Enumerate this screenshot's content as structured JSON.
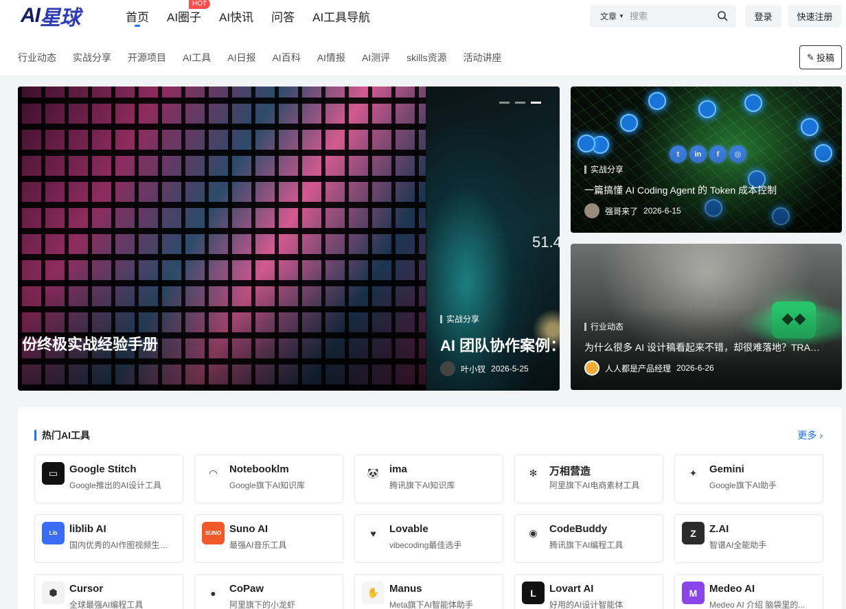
{
  "header": {
    "logo_text_a": "AI",
    "logo_text_b": "星球",
    "nav": [
      {
        "label": "首页",
        "active": true
      },
      {
        "label": "AI圈子"
      },
      {
        "label": "AI快讯"
      },
      {
        "label": "问答"
      },
      {
        "label": "AI工具导航"
      }
    ],
    "hot_badge": "HOT",
    "search": {
      "scope": "文章",
      "placeholder": "搜索"
    },
    "login": "登录",
    "register": "快速注册",
    "post_button": "投稿"
  },
  "subnav": [
    "行业动态",
    "实战分享",
    "开源项目",
    "AI工具",
    "AI日报",
    "AI百科",
    "AI情报",
    "AI测评",
    "skills资源",
    "活动讲座"
  ],
  "hero": {
    "slides": [
      {
        "title": "份终极实战经验手册"
      },
      {
        "category": "实战分享",
        "title": "AI 团队协作案例：",
        "author": "叶小钗",
        "date": "2026-5-25",
        "overlay_number": "51.4"
      }
    ],
    "side_cards": [
      {
        "category": "实战分享",
        "title": "一篇搞懂 AI Coding Agent 的 Token 成本控制",
        "author": "强哥来了",
        "date": "2026-6-15",
        "social": [
          "t",
          "in",
          "f",
          "◎"
        ]
      },
      {
        "category": "行业动态",
        "title": "为什么很多 AI 设计稿看起来不错，却很难落地？TRAE...",
        "author": "人人都是产品经理",
        "date": "2026-6-26"
      }
    ]
  },
  "tools_section": {
    "title": "热门AI工具",
    "more": "更多",
    "tools": [
      {
        "name": "Google Stitch",
        "desc": "Google推出的AI设计工具",
        "icon": "stitch-icon",
        "color": "#111111",
        "glyph": "▭"
      },
      {
        "name": "Notebooklm",
        "desc": "Google旗下AI知识库",
        "icon": "notebooklm-icon",
        "color": "#ffffff",
        "glyph": "◠"
      },
      {
        "name": "ima",
        "desc": "腾讯旗下AI知识库",
        "icon": "panda-icon",
        "color": "#ffffff",
        "glyph": "🐼"
      },
      {
        "name": "万相营造",
        "desc": "阿里旗下AI电商素材工具",
        "icon": "wanxiang-icon",
        "color": "#ffffff",
        "glyph": "✻"
      },
      {
        "name": "Gemini",
        "desc": "Google旗下AI助手",
        "icon": "gemini-icon",
        "color": "#ffffff",
        "glyph": "✦"
      },
      {
        "name": "liblib AI",
        "desc": "国内优秀的AI作图视频生成工具",
        "icon": "liblib-icon",
        "color": "#3b6cf6",
        "glyph": "Lib"
      },
      {
        "name": "Suno AI",
        "desc": "最强AI音乐工具",
        "icon": "suno-icon",
        "color": "#f0592a",
        "glyph": "SUNO"
      },
      {
        "name": "Lovable",
        "desc": "vibecoding最佳选手",
        "icon": "lovable-icon",
        "color": "#ffffff",
        "glyph": "♥"
      },
      {
        "name": "CodeBuddy",
        "desc": "腾讯旗下AI编程工具",
        "icon": "codebuddy-icon",
        "color": "#ffffff",
        "glyph": "◉"
      },
      {
        "name": "Z.AI",
        "desc": "智谱AI全能助手",
        "icon": "zai-icon",
        "color": "#2b2b2b",
        "glyph": "Z"
      },
      {
        "name": "Cursor",
        "desc": "全球最强AI编程工具",
        "icon": "cursor-icon",
        "color": "#f2f2f2",
        "glyph": "⬢"
      },
      {
        "name": "CoPaw",
        "desc": "阿里旗下的小龙虾",
        "icon": "copaw-icon",
        "color": "#ffffff",
        "glyph": "●"
      },
      {
        "name": "Manus",
        "desc": "Meta旗下AI智能体助手",
        "icon": "manus-icon",
        "color": "#f5f5f5",
        "glyph": "✋"
      },
      {
        "name": "Lovart AI",
        "desc": "好用的AI设计智能体",
        "icon": "lovart-icon",
        "color": "#111111",
        "glyph": "L"
      },
      {
        "name": "Medeo AI",
        "desc": "Medeo AI 介绍 脑袋里的...",
        "icon": "medeo-icon",
        "color": "#8a45e6",
        "glyph": "M"
      }
    ]
  }
}
